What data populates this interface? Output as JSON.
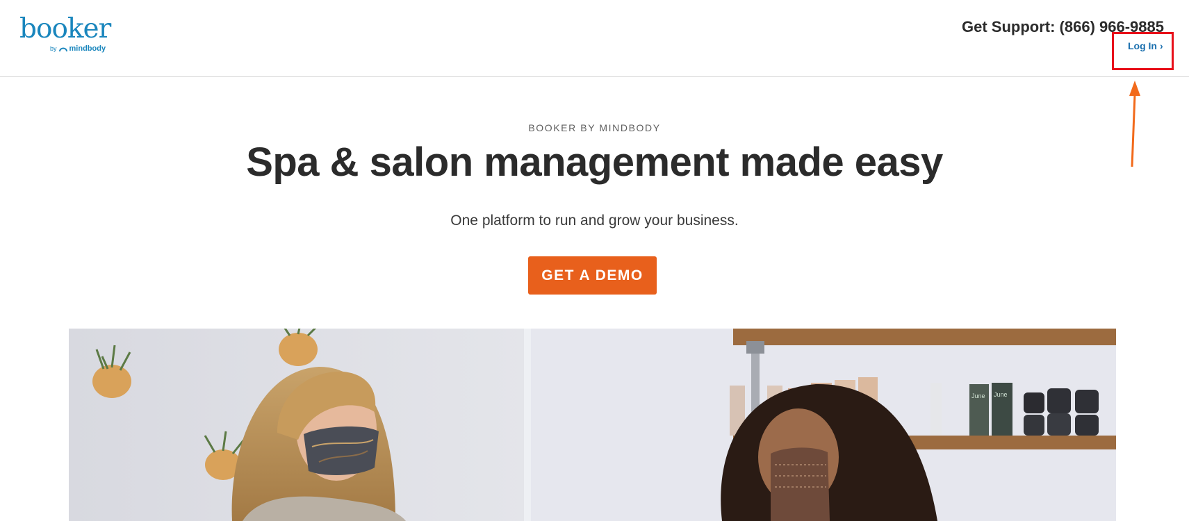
{
  "header": {
    "logo": {
      "word": "booker",
      "by": "by",
      "brand": "mindbody"
    },
    "support_text": "Get Support: (866) 966-9885",
    "login_label": "Log In",
    "login_chevron": "›"
  },
  "hero": {
    "eyebrow": "BOOKER BY MINDBODY",
    "headline": "Spa & salon management made easy",
    "subhead": "One platform to run and grow your business.",
    "cta_label": "GET A DEMO"
  },
  "colors": {
    "brand_blue": "#1a86bd",
    "cta_orange": "#e8601c",
    "annotation_red": "#e8101a",
    "annotation_arrow": "#f26a1b"
  },
  "photo": {
    "shelf_labels": [
      "June",
      "June"
    ]
  }
}
